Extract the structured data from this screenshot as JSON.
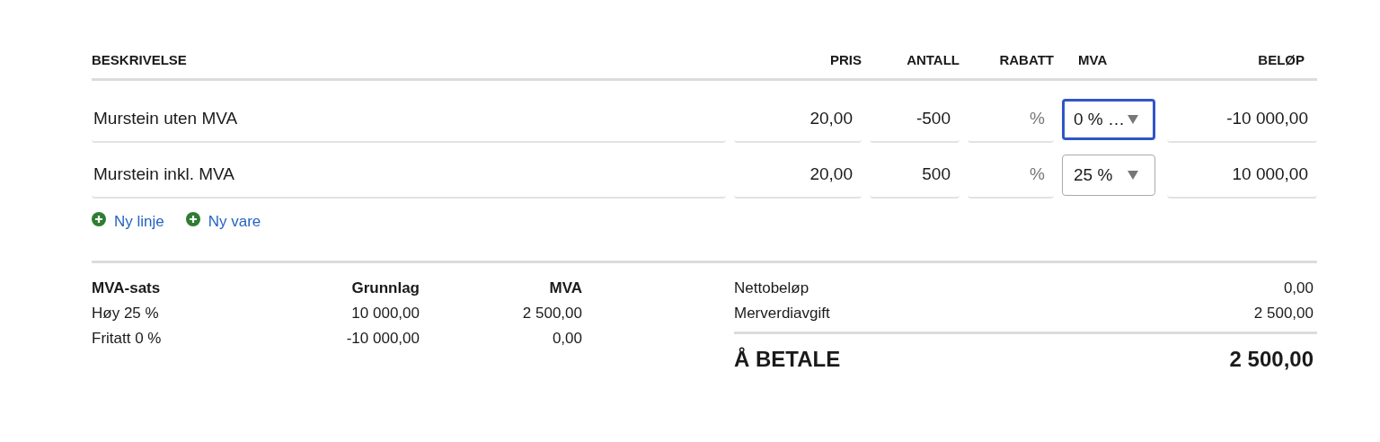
{
  "columns": [
    "BESKRIVELSE",
    "PRIS",
    "ANTALL",
    "RABATT",
    "MVA",
    "BELØP"
  ],
  "lines": [
    {
      "description": "Murstein uten MVA",
      "price": "20,00",
      "quantity": "-500",
      "discount_suffix": "%",
      "vat": "0 % …",
      "vat_focused": true,
      "amount": "-10 000,00"
    },
    {
      "description": "Murstein inkl. MVA",
      "price": "20,00",
      "quantity": "500",
      "discount_suffix": "%",
      "vat": "25 %",
      "vat_focused": false,
      "amount": "10 000,00"
    }
  ],
  "actions": [
    "Ny linje",
    "Ny vare"
  ],
  "vat_table": {
    "columns": [
      "MVA-sats",
      "Grunnlag",
      "MVA"
    ],
    "rows": [
      [
        "Høy 25 %",
        "10 000,00",
        "2 500,00"
      ],
      [
        "Fritatt 0 %",
        "-10 000,00",
        "0,00"
      ]
    ]
  },
  "totals": [
    {
      "label": "Nettobeløp",
      "value": "0,00"
    },
    {
      "label": "Merverdiavgift",
      "value": "2 500,00"
    }
  ],
  "grand_total": {
    "label": "Å BETALE",
    "value": "2 500,00"
  }
}
